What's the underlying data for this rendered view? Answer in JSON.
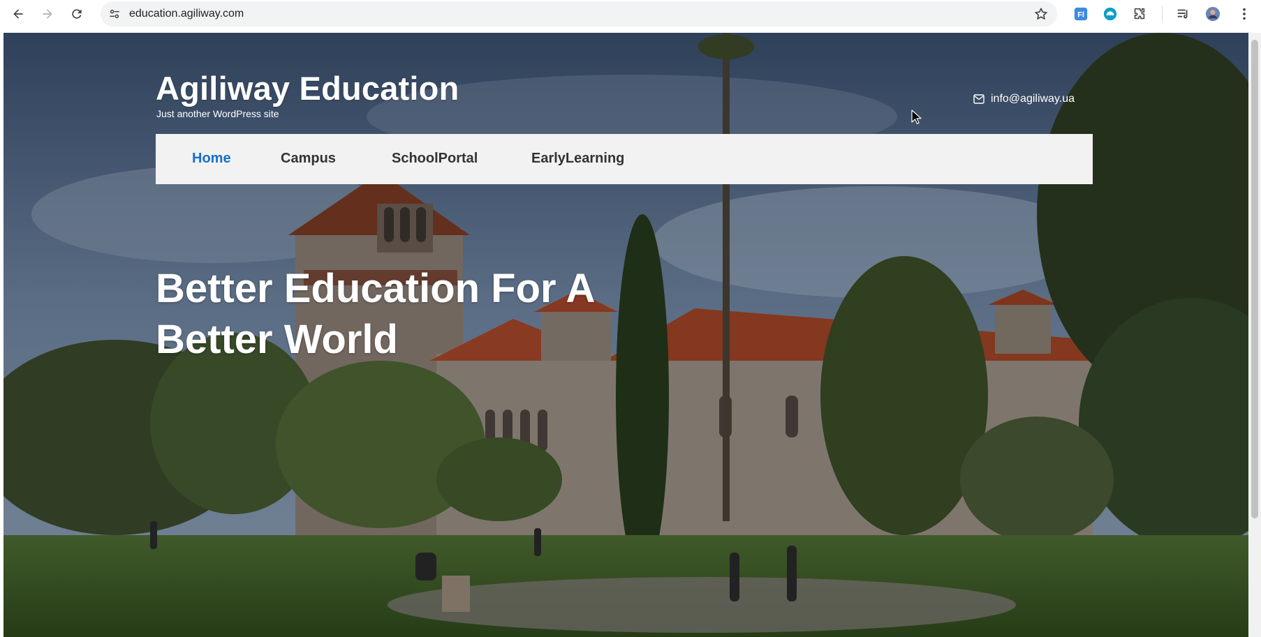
{
  "browser": {
    "url": "education.agiliway.com",
    "back_icon": "back-arrow-icon",
    "forward_icon": "forward-arrow-icon",
    "reload_icon": "reload-icon",
    "site_settings_icon": "tune-icon",
    "bookmark_icon": "star-icon",
    "extensions": [
      "fl-extension-icon",
      "blue-circle-extension-icon",
      "puzzle-extensions-icon",
      "reading-list-icon",
      "profile-avatar",
      "more-vert-icon"
    ]
  },
  "site": {
    "title": "Agiliway Education",
    "tagline": "Just another WordPress site",
    "contact_email": "info@agiliway.ua",
    "menu": [
      {
        "label": "Home",
        "active": true
      },
      {
        "label": "Campus",
        "active": false
      },
      {
        "label": "SchoolPortal",
        "active": false
      },
      {
        "label": "EarlyLearning",
        "active": false
      }
    ],
    "hero_heading": "Better Education For A Better World",
    "colors": {
      "menu_active": "#1570c9",
      "menu_text": "#333333",
      "menu_bg": "#f2f2f2"
    }
  }
}
